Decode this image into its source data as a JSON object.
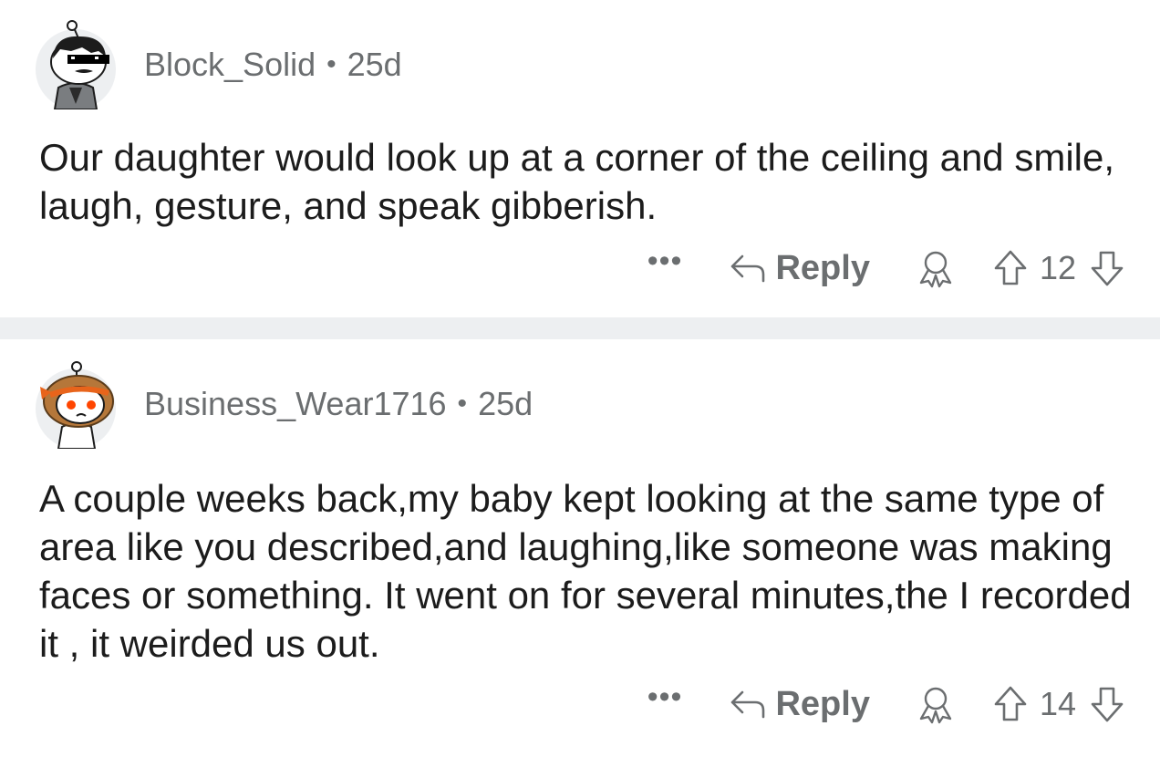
{
  "comments": [
    {
      "username": "Block_Solid",
      "separator": "•",
      "age": "25d",
      "body": "Our daughter would look up at a corner of the ceiling and smile, laugh, gesture, and speak gibberish.",
      "more_label": "•••",
      "reply_label": "Reply",
      "score": "12"
    },
    {
      "username": "Business_Wear1716",
      "separator": "•",
      "age": "25d",
      "body": "A couple weeks back,my baby kept looking at the same type of area like you described,and laughing,like someone was making faces or something. It went on for several minutes,the I recorded it , it weirded us out.",
      "more_label": "•••",
      "reply_label": "Reply",
      "score": "14"
    }
  ],
  "colors": {
    "meta_gray": "#6b6e70",
    "text": "#1c1c1c",
    "divider": "#edeff1",
    "avatar_bg": "#edeff1"
  },
  "icons": {
    "reply": "reply-arrow-icon",
    "award": "award-icon",
    "upvote": "upvote-arrow-icon",
    "downvote": "downvote-arrow-icon",
    "more": "more-options-icon"
  }
}
